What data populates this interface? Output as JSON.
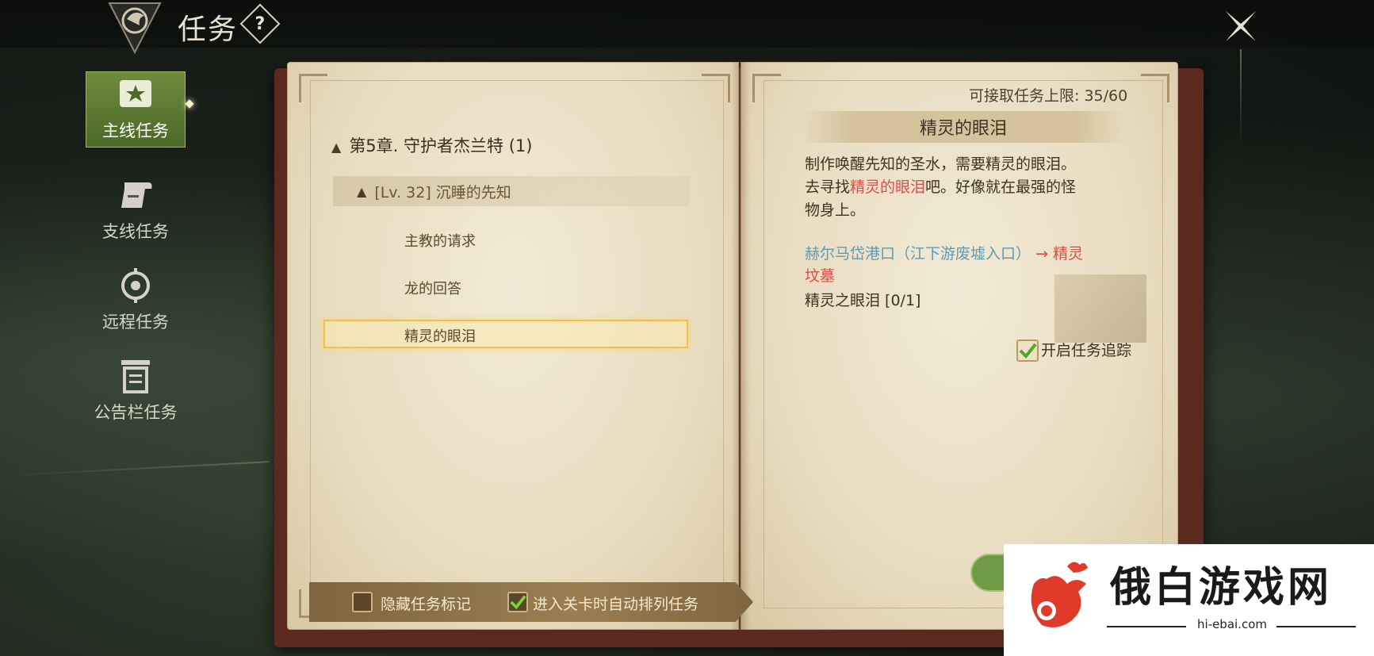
{
  "header": {
    "title": "任务",
    "help_label": "?"
  },
  "nav": {
    "items": [
      {
        "label": "主线任务",
        "icon": "scroll-star-icon",
        "active": true
      },
      {
        "label": "支线任务",
        "icon": "scroll-icon",
        "active": false
      },
      {
        "label": "远程任务",
        "icon": "target-icon",
        "active": false
      },
      {
        "label": "公告栏任务",
        "icon": "bulletin-icon",
        "active": false
      }
    ]
  },
  "left_page": {
    "chapter": "第5章. 守护者杰兰特 (1)",
    "group": "[Lv. 32] 沉睡的先知",
    "quests": [
      "主教的请求",
      "龙的回答",
      "精灵的眼泪"
    ],
    "selected_index": 2,
    "options": [
      {
        "label": "隐藏任务标记",
        "checked": false
      },
      {
        "label": "进入关卡时自动排列任务",
        "checked": true
      }
    ]
  },
  "right_page": {
    "limit": "可接取任务上限: 35/60",
    "quest_title": "精灵的眼泪",
    "desc_line1": "制作唤醒先知的圣水，需要精灵的眼泪。",
    "desc_line2_pre": "去寻找",
    "desc_line2_highlight": "精灵的眼泪",
    "desc_line2_post": "吧。好像就在最强的怪",
    "desc_line3": "物身上。",
    "location_from": "赫尔马岱港口（江下游废墟入口）",
    "location_arrow": "→",
    "location_to_1": "精灵",
    "location_to_2": "坟墓",
    "progress": "精灵之眼泪 [0/1]",
    "track_label": "开启任务追踪",
    "track_checked": true
  },
  "watermark": {
    "text": "俄白游戏网",
    "url": "hi-ebai.com"
  },
  "colors": {
    "accent_green": "#6e8a3d",
    "highlight_red": "#d7504a",
    "location_blue": "#5b9bb8",
    "select_gold": "#f0c04a"
  }
}
